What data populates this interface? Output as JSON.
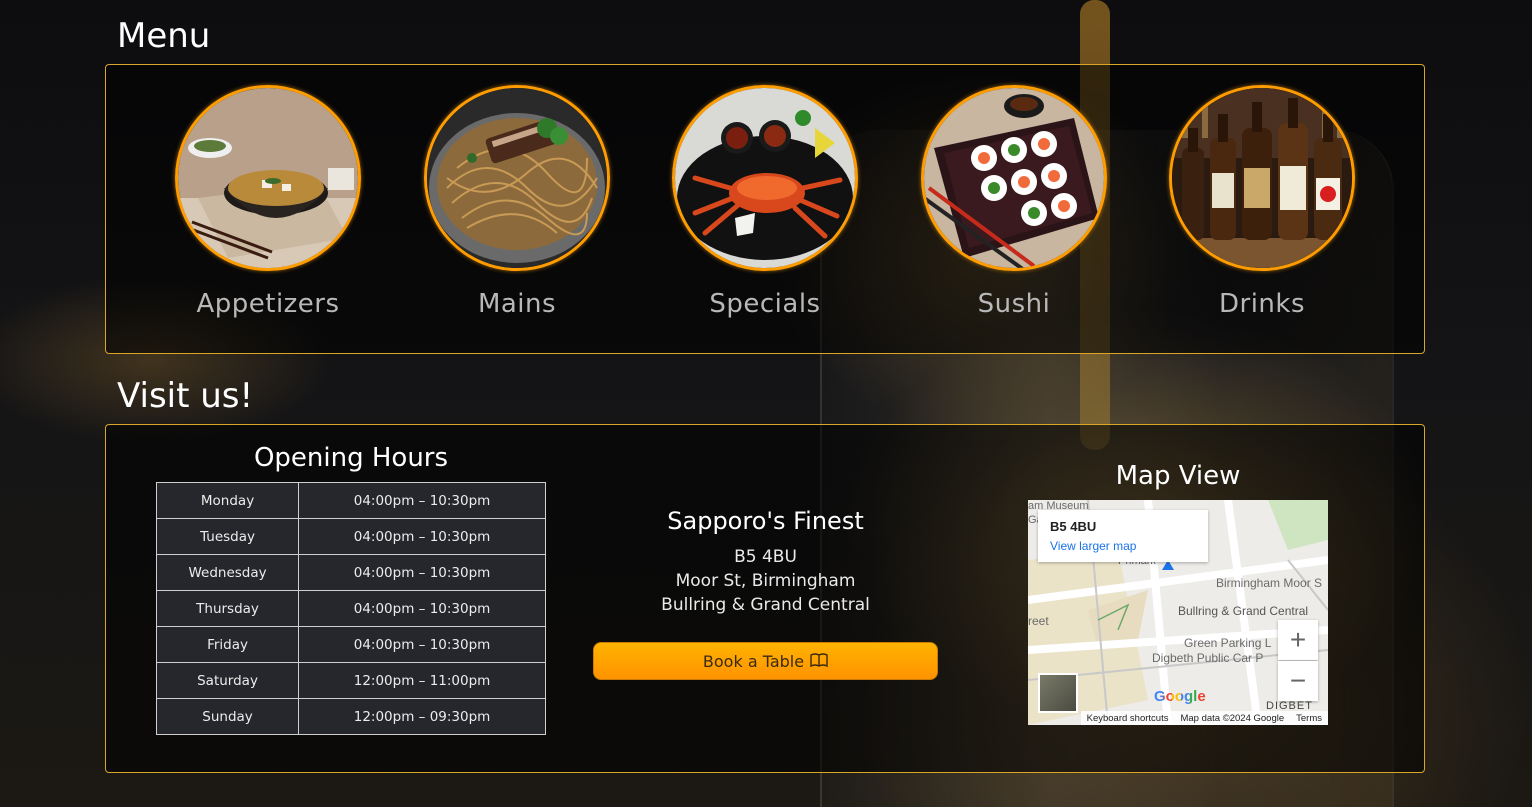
{
  "menu": {
    "title": "Menu",
    "items": [
      {
        "label": "Appetizers",
        "icon": "miso-soup-image"
      },
      {
        "label": "Mains",
        "icon": "noodles-image"
      },
      {
        "label": "Specials",
        "icon": "crab-image"
      },
      {
        "label": "Sushi",
        "icon": "sushi-image"
      },
      {
        "label": "Drinks",
        "icon": "sake-bottles-image"
      }
    ]
  },
  "visit": {
    "title": "Visit us!",
    "hours_title": "Opening Hours",
    "hours": [
      {
        "day": "Monday",
        "time": "04:00pm – 10:30pm"
      },
      {
        "day": "Tuesday",
        "time": "04:00pm – 10:30pm"
      },
      {
        "day": "Wednesday",
        "time": "04:00pm – 10:30pm"
      },
      {
        "day": "Thursday",
        "time": "04:00pm – 10:30pm"
      },
      {
        "day": "Friday",
        "time": "04:00pm – 10:30pm"
      },
      {
        "day": "Saturday",
        "time": "12:00pm – 11:00pm"
      },
      {
        "day": "Sunday",
        "time": "12:00pm – 09:30pm"
      }
    ],
    "address": {
      "name": "Sapporo's Finest",
      "postcode": "B5 4BU",
      "street": "Moor St, Birmingham",
      "area": "Bullring & Grand Central"
    },
    "book_label": "Book a Table",
    "book_icon": "book-open-icon",
    "map_title": "Map View",
    "map": {
      "card_title": "B5 4BU",
      "card_link": "View larger map",
      "labels": {
        "moor": "Birmingham Moor S",
        "bullring": "Bullring & Grand Central",
        "green": "Green Parking L",
        "digbeth": "Digbeth Public Car P",
        "museum": "am Museum",
        "gallery": "Gallery",
        "street": "reet",
        "primark": "Primark",
        "digbeth_area": "DIGBET"
      },
      "zoom_in": "+",
      "zoom_out": "−",
      "logo": "Google",
      "footer": [
        "Keyboard shortcuts",
        "Map data ©2024 Google",
        "Terms"
      ]
    }
  },
  "colors": {
    "accent_border": "#d9a628",
    "circle_border": "#ff9d00",
    "button": "#ffa600",
    "map_link": "#1a73e8"
  }
}
